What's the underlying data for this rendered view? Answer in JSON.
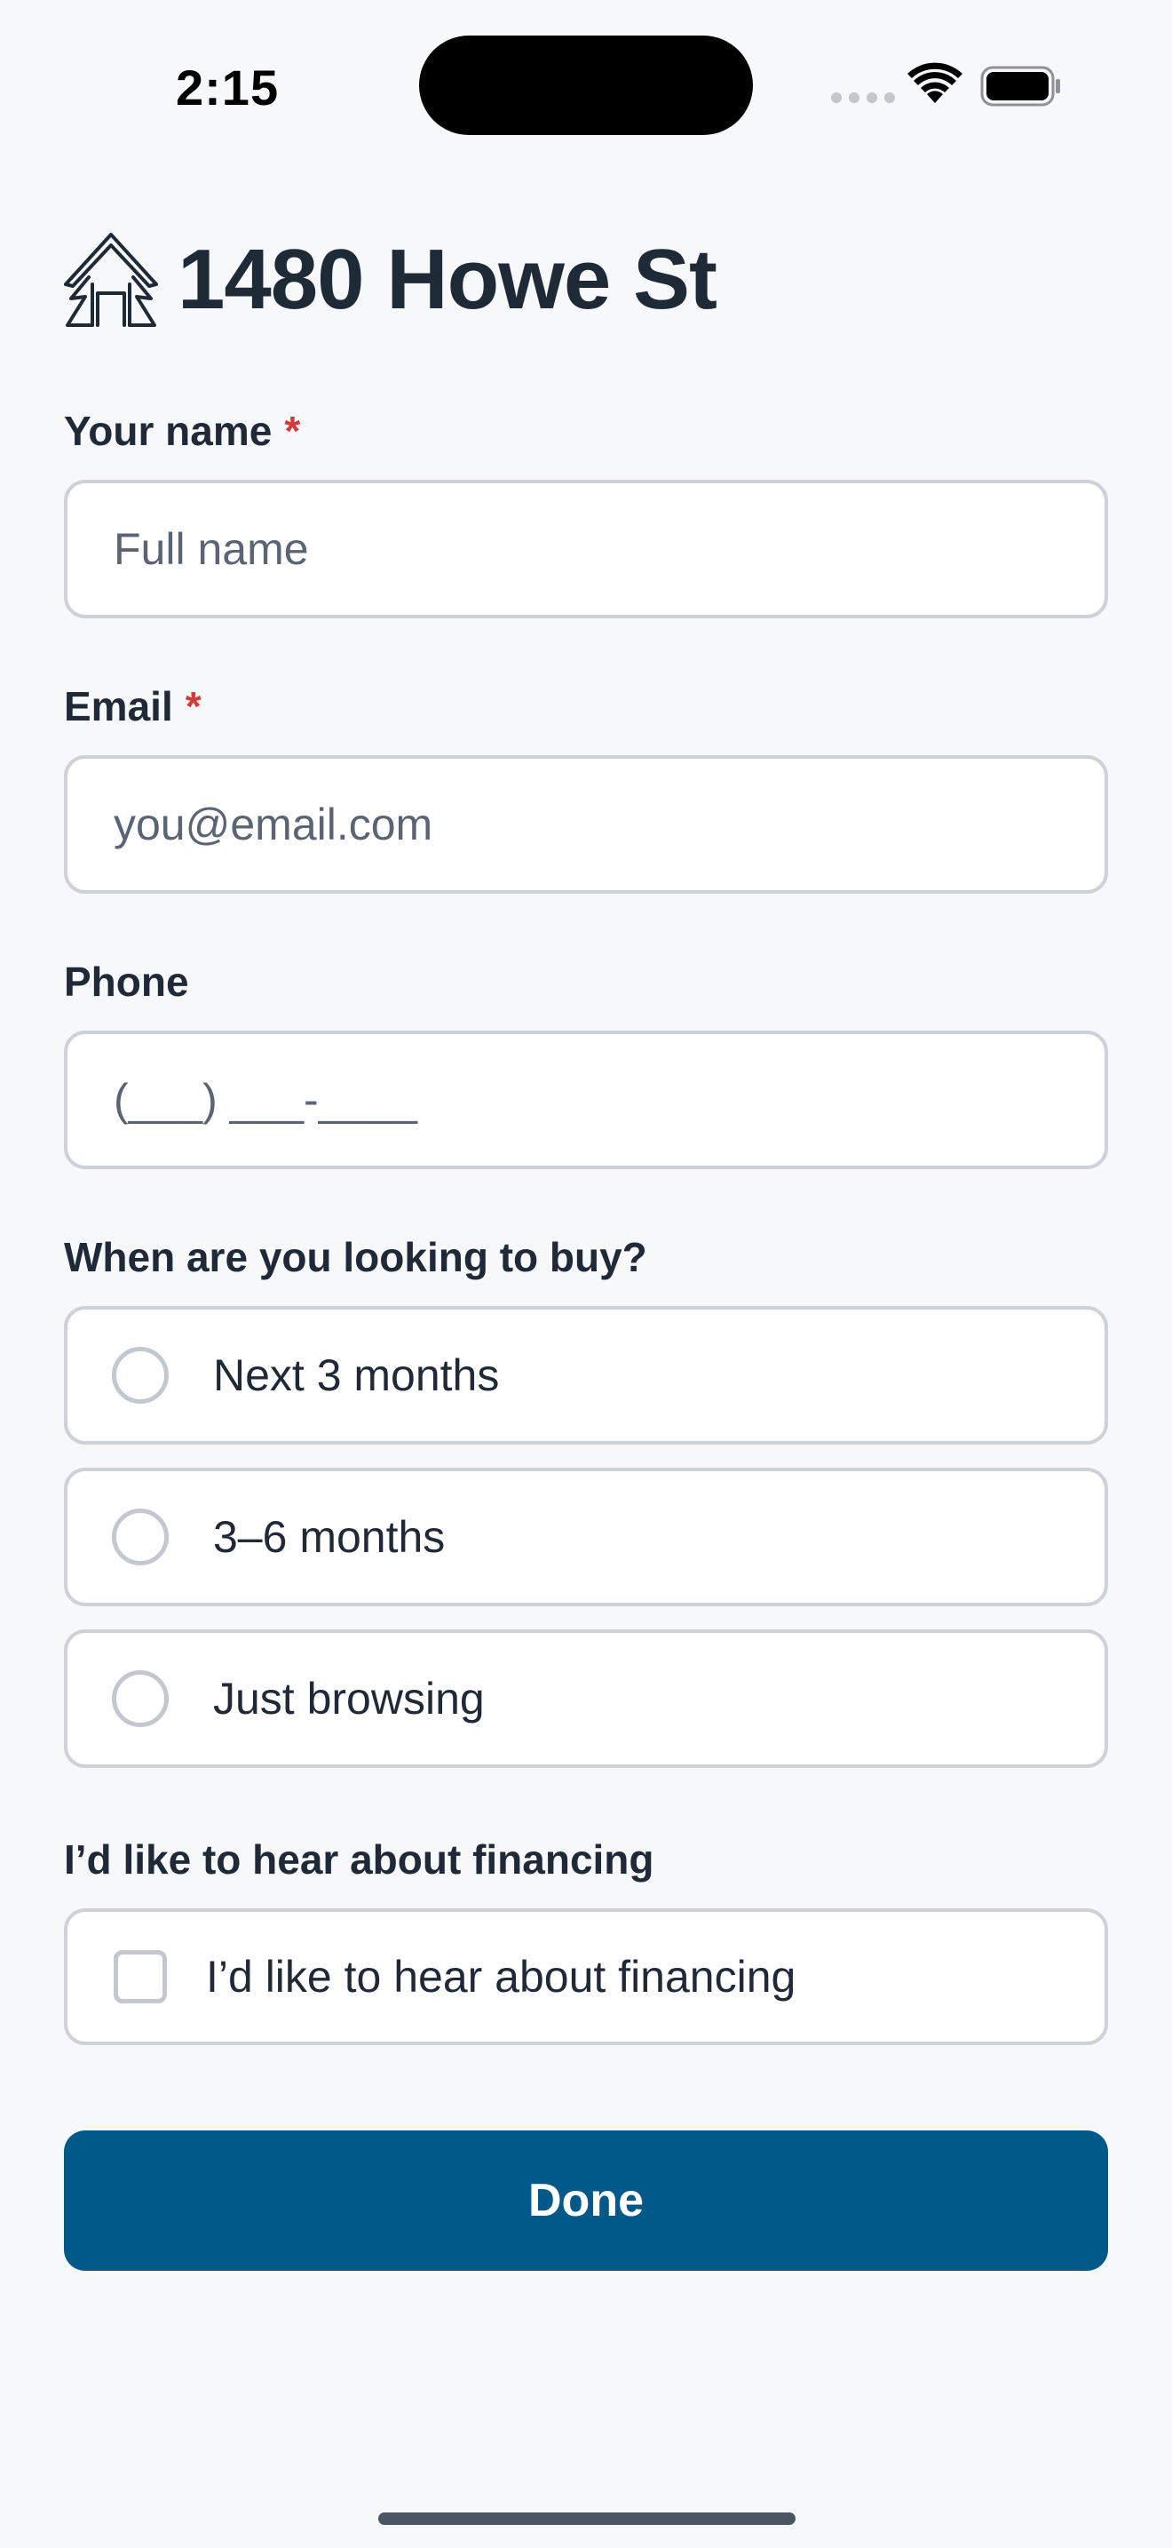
{
  "status_bar": {
    "time": "2:15",
    "icons": [
      "signal-icon",
      "wifi-icon",
      "battery-icon"
    ]
  },
  "header": {
    "logo_icon": "house-trees-logo-icon",
    "title": "1480 Howe St"
  },
  "form": {
    "name": {
      "label": "Your name",
      "required_mark": "*",
      "placeholder": "Full name"
    },
    "email": {
      "label": "Email",
      "required_mark": "*",
      "placeholder": "you@email.com"
    },
    "phone": {
      "label": "Phone",
      "placeholder": "(___) ___-____"
    },
    "timeline": {
      "label": "When are you looking to buy?",
      "options": [
        {
          "label": "Next 3 months",
          "selected": false
        },
        {
          "label": "3–6 months",
          "selected": false
        },
        {
          "label": "Just browsing",
          "selected": false
        }
      ]
    },
    "financing": {
      "label": "I’d like to hear about financing",
      "checkbox_label": "I’d like to hear about financing",
      "checked": false
    },
    "submit_label": "Done"
  },
  "colors": {
    "background": "#f7f8fa",
    "primary_button": "#005989",
    "required_mark": "#d33a3a",
    "border": "#cdd2da"
  }
}
